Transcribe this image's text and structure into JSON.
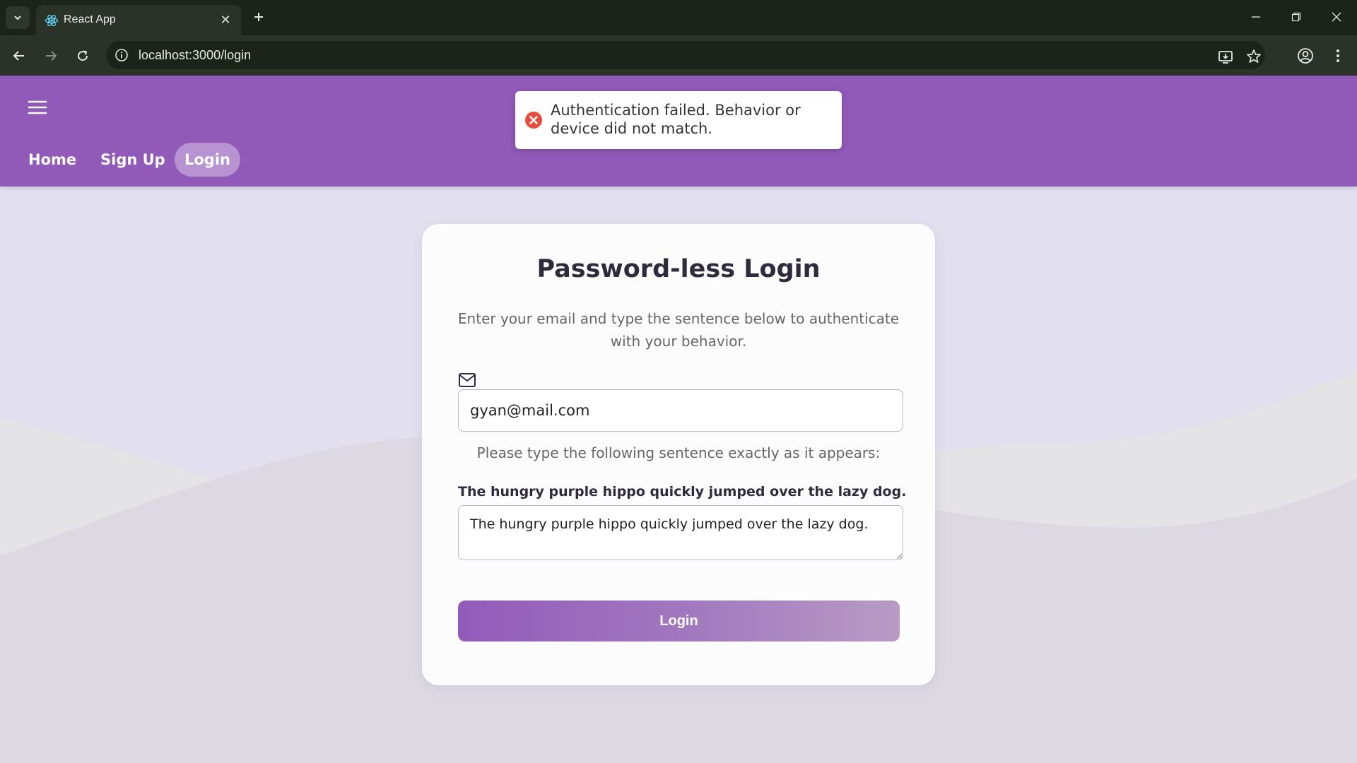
{
  "browser": {
    "tab_title": "React App",
    "url": "localhost:3000/login"
  },
  "nav": {
    "items": [
      {
        "label": "Home",
        "active": false
      },
      {
        "label": "Sign Up",
        "active": false
      },
      {
        "label": "Login",
        "active": true
      }
    ]
  },
  "toast": {
    "type": "error",
    "message": "Authentication failed. Behavior or device did not match."
  },
  "login_card": {
    "title": "Password-less Login",
    "subtitle": "Enter your email and type the sentence below to authenticate with your behavior.",
    "email_value": "gyan@mail.com",
    "instruction": "Please type the following sentence exactly as it appears:",
    "sentence": "The hungry purple hippo quickly jumped over the lazy dog.",
    "typed_value": "The hungry purple hippo quickly jumped over the lazy dog.",
    "submit_label": "Login"
  },
  "colors": {
    "header": "#9159b8",
    "error": "#e74c3c",
    "background": "#e2e0ef"
  }
}
